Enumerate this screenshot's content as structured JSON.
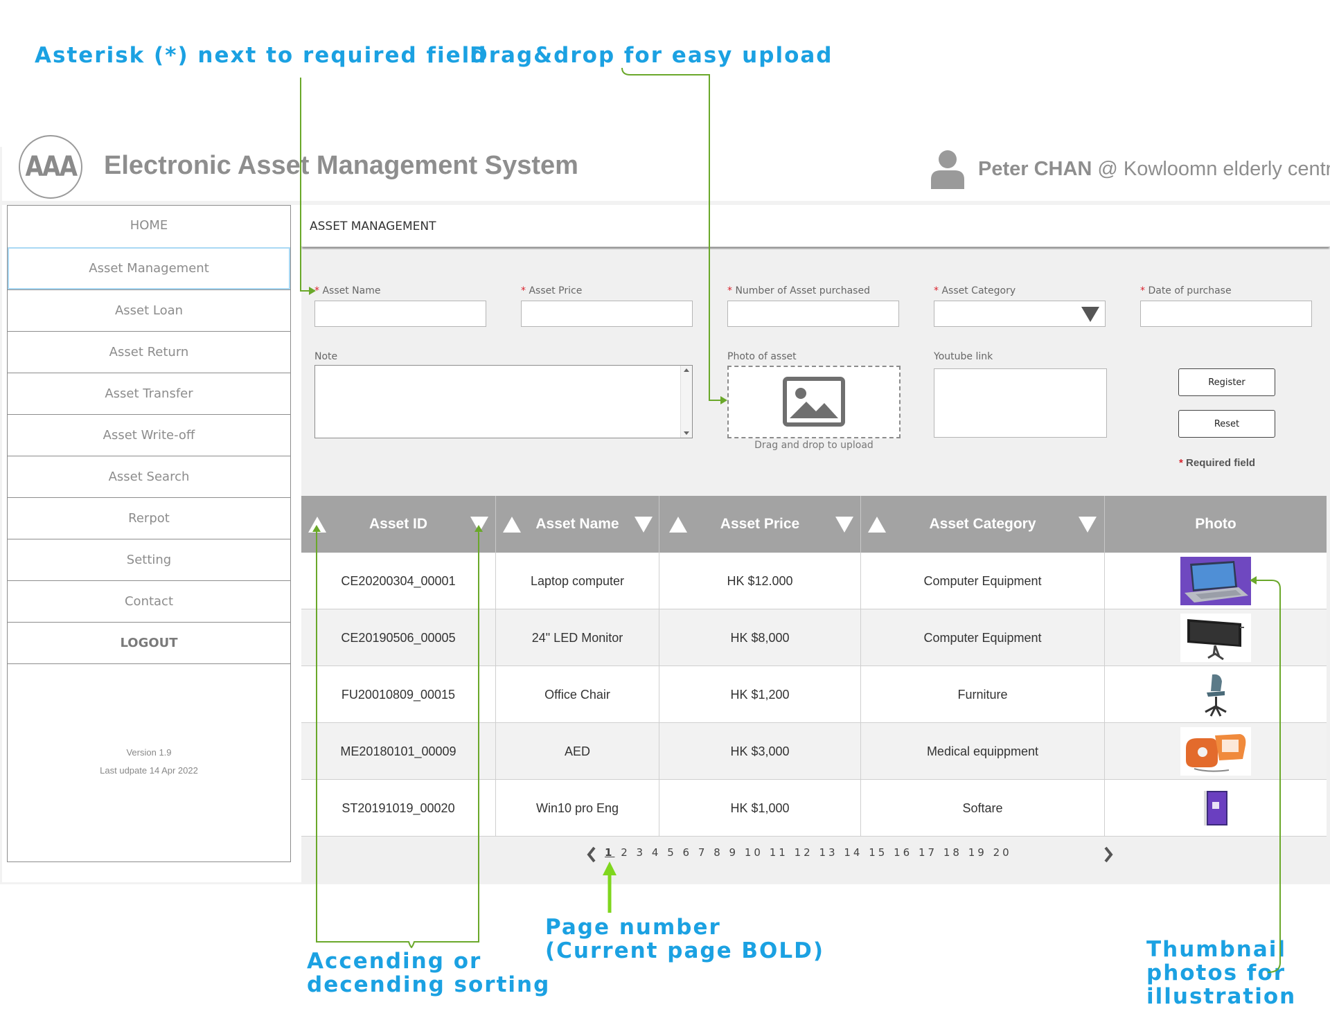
{
  "annotations": {
    "required": "Asterisk (*) next to required field",
    "dragdrop": "Drag&drop for easy upload",
    "sorting_l1": "Accending or",
    "sorting_l2": "decending sorting",
    "page_l1": "Page number",
    "page_l2": "(Current page BOLD)",
    "thumb_l1": "Thumbnail",
    "thumb_l2": "photos for",
    "thumb_l3": "illustration"
  },
  "header": {
    "logo": "AAA",
    "title": "Electronic Asset Management System",
    "user_name": "Peter CHAN",
    "user_org": " @ Kowloomn elderly centre",
    "user_icon": "user-icon"
  },
  "sidebar": {
    "items": [
      {
        "label": "HOME"
      },
      {
        "label": "Asset Management"
      },
      {
        "label": "Asset Loan"
      },
      {
        "label": "Asset Return"
      },
      {
        "label": "Asset Transfer"
      },
      {
        "label": "Asset Write-off"
      },
      {
        "label": "Asset Search"
      },
      {
        "label": "Rerpot"
      },
      {
        "label": "Setting"
      },
      {
        "label": "Contact"
      },
      {
        "label": "LOGOUT"
      }
    ],
    "version": "Version 1.9",
    "last_update": "Last udpate 14 Apr 2022"
  },
  "main": {
    "section_title": "ASSET MANAGEMENT"
  },
  "form": {
    "asterisk": "*",
    "asset_name_label": "Asset Name",
    "asset_price_label": "Asset Price",
    "number_label": "Number of Asset purchased",
    "category_label": "Asset Category",
    "date_label": "Date of purchase",
    "note_label": "Note",
    "photo_label": "Photo of asset",
    "drop_hint": "Drag and drop to upload",
    "youtube_label": "Youtube link",
    "register_label": "Register",
    "reset_label": "Reset",
    "required_note": "Required field"
  },
  "table": {
    "headers": [
      "Asset ID",
      "Asset Name",
      "Asset Price",
      "Asset Category",
      "Photo"
    ],
    "rows": [
      {
        "id": "CE20200304_00001",
        "name": "Laptop computer",
        "price": "HK $12.000",
        "category": "Computer Equipment",
        "photo": "laptop-thumbnail"
      },
      {
        "id": "CE20190506_00005",
        "name": "24\" LED Monitor",
        "price": "HK $8,000",
        "category": "Computer Equipment",
        "photo": "monitor-thumbnail"
      },
      {
        "id": "FU20010809_00015",
        "name": "Office Chair",
        "price": "HK $1,200",
        "category": "Furniture",
        "photo": "chair-thumbnail"
      },
      {
        "id": "ME20180101_00009",
        "name": "AED",
        "price": "HK $3,000",
        "category": "Medical equippment",
        "photo": "aed-thumbnail"
      },
      {
        "id": "ST20191019_00020",
        "name": "Win10 pro Eng",
        "price": "HK $1,000",
        "category": "Softare",
        "photo": "software-box-thumbnail"
      }
    ]
  },
  "pagination": {
    "current": "1",
    "pages": [
      "2",
      "3",
      "4",
      "5",
      "6",
      "7",
      "8",
      "9",
      "10",
      "11",
      "12",
      "13",
      "14",
      "15",
      "16",
      "17",
      "18",
      "19",
      "20"
    ]
  },
  "colors": {
    "annotation": "#1ba1e2",
    "annotation_line": "#6aa82a",
    "required_star": "#d9232d",
    "table_header": "#a3a3a3",
    "active_nav_border": "#a8d8f4"
  }
}
